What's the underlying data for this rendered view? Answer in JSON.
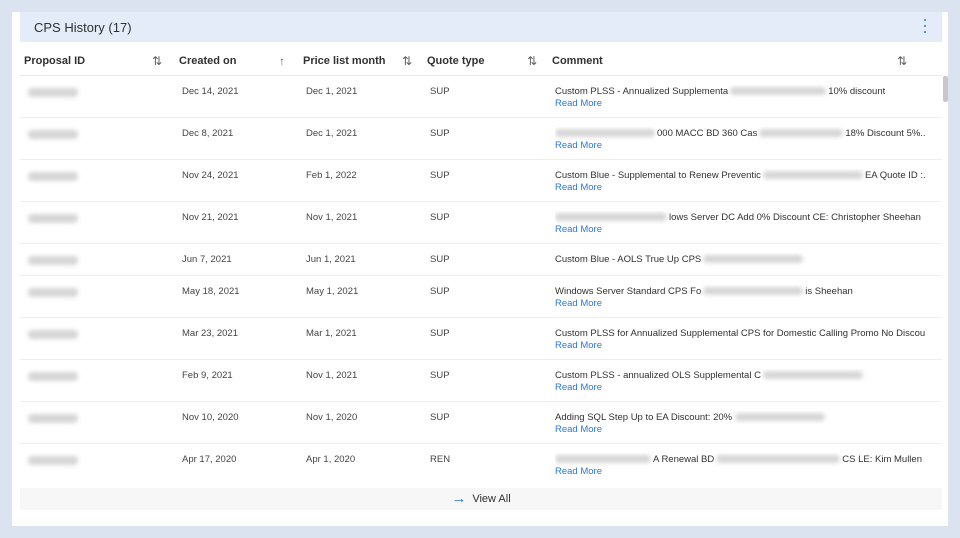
{
  "panel": {
    "title": "CPS History (17)",
    "more_icon": "more-vertical-icon"
  },
  "columns": [
    {
      "label": "Proposal ID",
      "sort_icon": "⇅"
    },
    {
      "label": "Created on",
      "sort_icon": "↑"
    },
    {
      "label": "Price list month",
      "sort_icon": "⇅"
    },
    {
      "label": "Quote type",
      "sort_icon": "⇅"
    },
    {
      "label": "Comment",
      "sort_icon": "⇅"
    }
  ],
  "rows": [
    {
      "created": "Dec 14, 2021",
      "month": "Dec 1, 2021",
      "type": "SUP",
      "comment": [
        "Custom PLSS - Annualized Supplementa",
        "10% discount"
      ],
      "read_more": "Read More"
    },
    {
      "created": "Dec 8, 2021",
      "month": "Dec 1, 2021",
      "type": "SUP",
      "comment": [
        "",
        "000 MACC BD 360 Cas",
        "18% Discount 5%..."
      ],
      "read_more": "Read More"
    },
    {
      "created": "Nov 24, 2021",
      "month": "Feb 1, 2022",
      "type": "SUP",
      "comment": [
        "Custom Blue - Supplemental to Renew Preventic",
        "EA Quote ID :..."
      ],
      "read_more": "Read More"
    },
    {
      "created": "Nov 21, 2021",
      "month": "Nov 1, 2021",
      "type": "SUP",
      "comment": [
        "",
        "lows Server DC Add 0% Discount CE: Christopher Sheehan"
      ],
      "read_more": "Read More"
    },
    {
      "created": "Jun 7, 2021",
      "month": "Jun 1, 2021",
      "type": "SUP",
      "comment": [
        "Custom Blue - AOLS True Up CPS"
      ],
      "read_more": ""
    },
    {
      "created": "May 18, 2021",
      "month": "May 1, 2021",
      "type": "SUP",
      "comment": [
        "Windows Server Standard CPS Fo",
        "is Sheehan"
      ],
      "read_more": "Read More"
    },
    {
      "created": "Mar 23, 2021",
      "month": "Mar 1, 2021",
      "type": "SUP",
      "comment": [
        "Custom PLSS for Annualized Supplemental CPS for Domestic Calling Promo No Discount..."
      ],
      "read_more": "Read More"
    },
    {
      "created": "Feb 9, 2021",
      "month": "Nov 1, 2021",
      "type": "SUP",
      "comment": [
        "Custom PLSS - annualized OLS Supplemental C"
      ],
      "read_more": "Read More"
    },
    {
      "created": "Nov 10, 2020",
      "month": "Nov 1, 2020",
      "type": "SUP",
      "comment": [
        "Adding SQL Step Up to EA Discount: 20%"
      ],
      "read_more": "Read More"
    },
    {
      "created": "Apr 17, 2020",
      "month": "Apr 1, 2020",
      "type": "REN",
      "comment": [
        "",
        "A Renewal BD",
        "CS LE: Kim Mullen CE..."
      ],
      "read_more": "Read More"
    }
  ],
  "footer": {
    "view_all": "View All",
    "arrow_icon": "arrow-right-icon"
  }
}
